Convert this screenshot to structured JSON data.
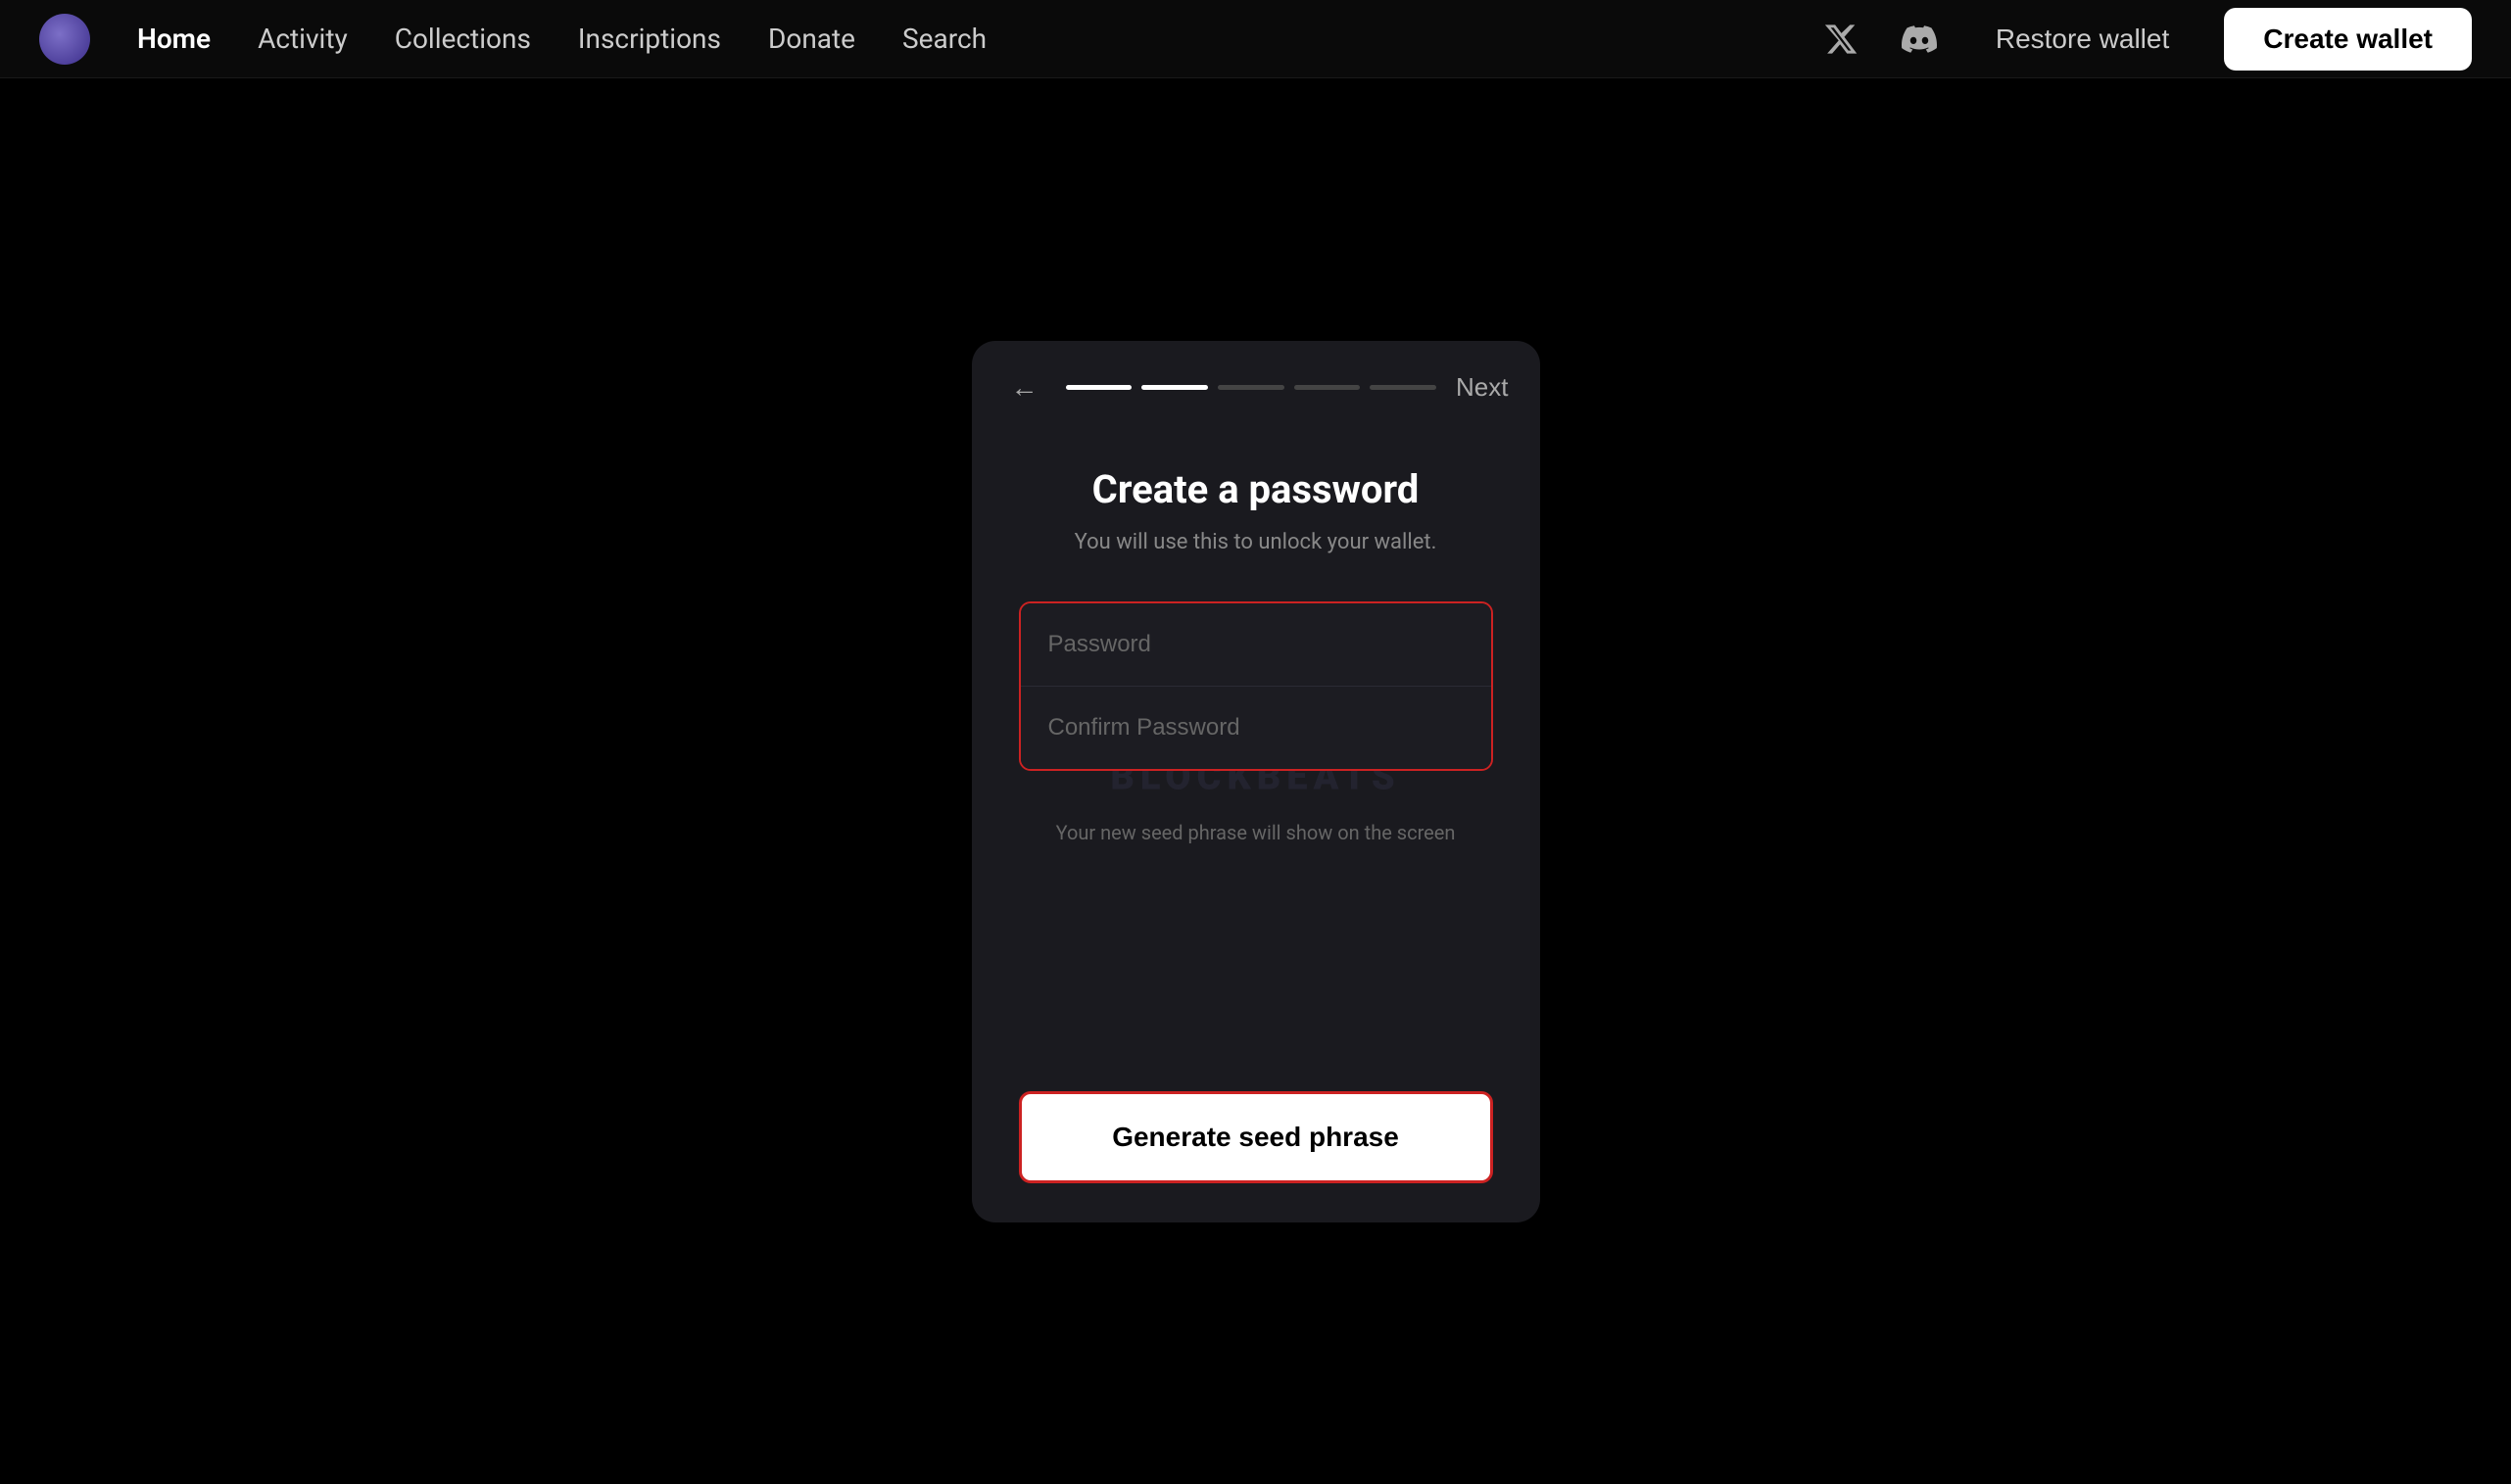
{
  "nav": {
    "logo_label": "Logo",
    "links": [
      {
        "id": "home",
        "label": "Home",
        "active": true
      },
      {
        "id": "activity",
        "label": "Activity",
        "active": false
      },
      {
        "id": "collections",
        "label": "Collections",
        "active": false
      },
      {
        "id": "inscriptions",
        "label": "Inscriptions",
        "active": false
      },
      {
        "id": "donate",
        "label": "Donate",
        "active": false
      },
      {
        "id": "search",
        "label": "Search",
        "active": false
      }
    ],
    "restore_label": "Restore wallet",
    "create_label": "Create wallet"
  },
  "card": {
    "back_label": "←",
    "next_label": "Next",
    "steps": [
      {
        "active": true
      },
      {
        "active": true
      },
      {
        "active": false
      },
      {
        "active": false
      },
      {
        "active": false
      }
    ],
    "title": "Create a password",
    "subtitle": "You will use this to unlock your wallet.",
    "password_placeholder": "Password",
    "confirm_placeholder": "Confirm Password",
    "seed_note": "Your new seed phrase will show on the screen",
    "generate_label": "Generate seed phrase",
    "watermark": "BLOCKBEATS"
  }
}
